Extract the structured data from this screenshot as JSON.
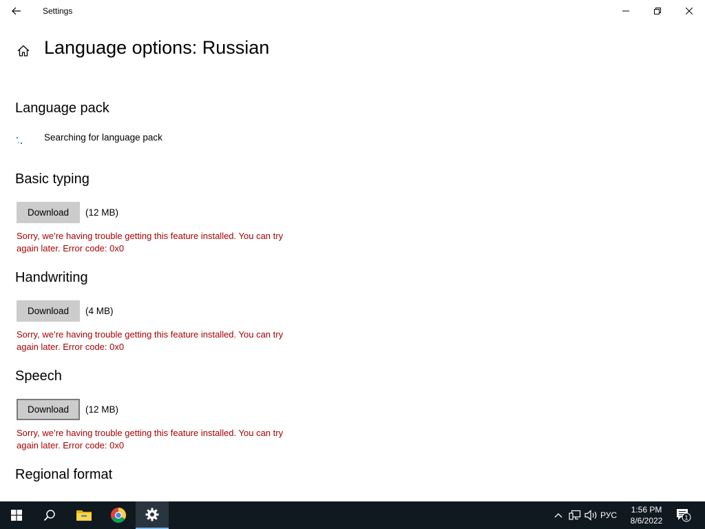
{
  "window": {
    "title": "Settings"
  },
  "page": {
    "title": "Language options: Russian"
  },
  "language_pack": {
    "heading": "Language pack",
    "status": "Searching for language pack"
  },
  "features": [
    {
      "heading": "Basic typing",
      "button": "Download",
      "size": "(12 MB)",
      "error_line1": "Sorry, we’re having trouble getting this feature installed. You can try",
      "error_line2": "again later. Error code: 0x0"
    },
    {
      "heading": "Handwriting",
      "button": "Download",
      "size": "(4 MB)",
      "error_line1": "Sorry, we’re having trouble getting this feature installed. You can try",
      "error_line2": "again later. Error code: 0x0"
    },
    {
      "heading": "Speech",
      "button": "Download",
      "size": "(12 MB)",
      "error_line1": "Sorry, we’re having trouble getting this feature installed. You can try",
      "error_line2": "again later. Error code: 0x0"
    }
  ],
  "regional_format": {
    "heading": "Regional format"
  },
  "taskbar": {
    "input_language": "РУС",
    "time": "1:56 PM",
    "date": "8/6/2022",
    "notification_count": "1",
    "pinned": [
      "start-icon",
      "search-icon",
      "file-explorer-icon",
      "chrome-icon",
      "settings-icon"
    ]
  },
  "colors": {
    "error": "#a80000",
    "button_bg": "#cccccc",
    "taskbar_bg": "#101820",
    "accent": "#0078d7"
  }
}
